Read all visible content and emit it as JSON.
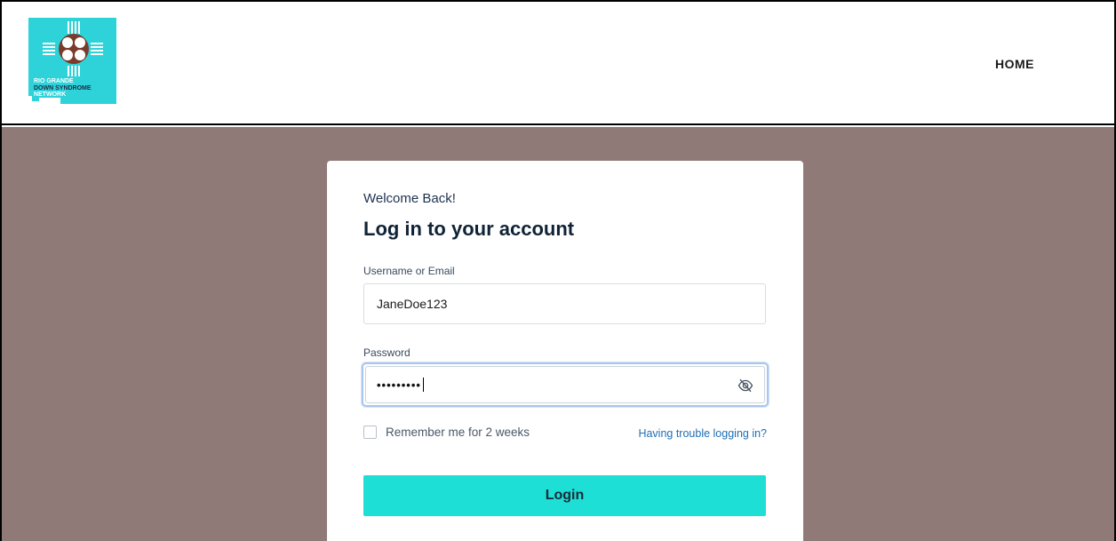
{
  "logo": {
    "line1": "RIO GRANDE",
    "line2": "DOWN SYNDROME",
    "line3": "NETWORK",
    "bg_color": "#2ed3d9"
  },
  "nav": {
    "home_label": "HOME"
  },
  "login": {
    "welcome": "Welcome Back!",
    "title": "Log in to your account",
    "username_label": "Username or Email",
    "username_value": "JaneDoe123",
    "password_label": "Password",
    "password_masked": "•••••••••",
    "password_toggle_icon": "eye-off-icon",
    "remember_label": "Remember me for 2 weeks",
    "remember_checked": false,
    "trouble_link": "Having trouble logging in?",
    "submit_label": "Login"
  },
  "colors": {
    "page_bg": "#8f7a77",
    "button_bg": "#1ddfd6",
    "link": "#1f6fb5"
  }
}
